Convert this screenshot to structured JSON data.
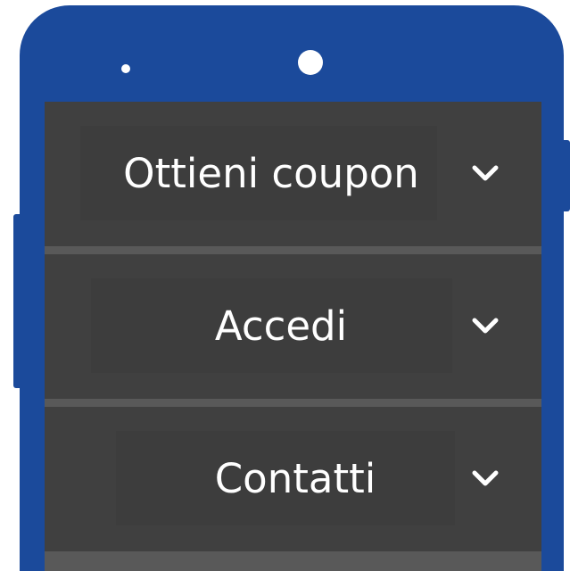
{
  "menu": {
    "items": [
      {
        "label": "Ottieni coupon",
        "icon": "chevron-down-icon"
      },
      {
        "label": "Accedi",
        "icon": "chevron-down-icon"
      },
      {
        "label": "Contatti",
        "icon": "chevron-down-icon"
      }
    ]
  },
  "colors": {
    "device_frame": "#1b4a9b",
    "menu_row": "#404040",
    "divider": "#595959",
    "text": "#ffffff"
  }
}
